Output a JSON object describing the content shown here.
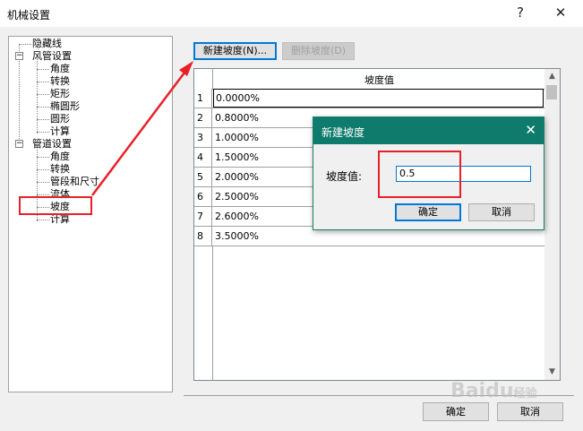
{
  "window": {
    "title": "机械设置",
    "help_glyph": "?",
    "close_glyph": "✕"
  },
  "tree": {
    "items": [
      {
        "label": "隐藏线"
      },
      {
        "label": "风管设置",
        "expander": "−"
      },
      {
        "label": "角度"
      },
      {
        "label": "转换"
      },
      {
        "label": "矩形"
      },
      {
        "label": "椭圆形"
      },
      {
        "label": "圆形"
      },
      {
        "label": "计算"
      },
      {
        "label": "管道设置",
        "expander": "−"
      },
      {
        "label": "角度"
      },
      {
        "label": "转换"
      },
      {
        "label": "管段和尺寸"
      },
      {
        "label": "流体"
      },
      {
        "label": "坡度"
      },
      {
        "label": "计算"
      }
    ]
  },
  "toolbar": {
    "new_slope_label": "新建坡度(N)...",
    "delete_slope_label": "删除坡度(D)"
  },
  "grid": {
    "header": "坡度值",
    "rows": [
      {
        "num": "1",
        "value": "0.0000%"
      },
      {
        "num": "2",
        "value": "0.8000%"
      },
      {
        "num": "3",
        "value": "1.0000%"
      },
      {
        "num": "4",
        "value": "1.5000%"
      },
      {
        "num": "5",
        "value": "2.0000%"
      },
      {
        "num": "6",
        "value": "2.5000%"
      },
      {
        "num": "7",
        "value": "2.6000%"
      },
      {
        "num": "8",
        "value": "3.5000%"
      }
    ],
    "scroll_up_glyph": "▲",
    "scroll_down_glyph": "▼"
  },
  "dialog": {
    "title": "新建坡度",
    "close_glyph": "✕",
    "field_label": "坡度值:",
    "field_value": "0.5",
    "ok_label": "确定",
    "cancel_label": "取消"
  },
  "footer": {
    "ok_label": "确定",
    "cancel_label": "取消"
  },
  "watermark": {
    "brand": "Baidu",
    "suffix": "经验"
  },
  "colors": {
    "dialog_title_bg": "#0f7b6c",
    "annotation_red": "#e8202a",
    "focus_blue": "#0078d7"
  }
}
